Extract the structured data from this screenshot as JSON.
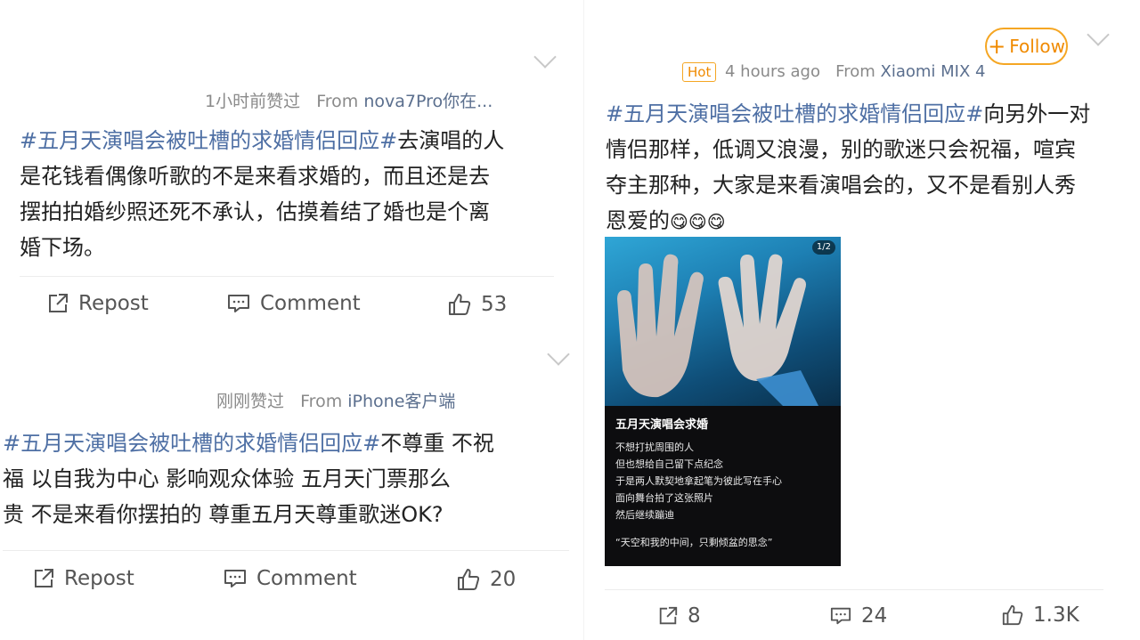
{
  "left_top_post": {
    "meta_time": "1小时前赞过",
    "from_label": "From",
    "device": "nova7Pro你在...",
    "hashtag": "#五月天演唱会被吐槽的求婚情侣回应#",
    "lines": [
      "去演唱的人",
      "是花钱看偶像听歌的不是来看求婚的，而且还是去",
      "摆拍拍婚纱照还死不承认，估摸着结了婚也是个离",
      "婚下场。"
    ],
    "repost_label": "Repost",
    "comment_label": "Comment",
    "like_count": "53"
  },
  "left_bottom_post": {
    "meta_time": "刚刚赞过",
    "from_label": "From",
    "device": "iPhone客户端",
    "hashtag": "#五月天演唱会被吐槽的求婚情侣回应#",
    "lines": [
      "不尊重 不祝",
      "福  以自我为中心  影响观众体验  五月天门票那么",
      "贵 不是来看你摆拍的  尊重五月天尊重歌迷OK?"
    ],
    "repost_label": "Repost",
    "comment_label": "Comment",
    "like_count": "20"
  },
  "right_post": {
    "follow_label": "Follow",
    "hot_badge": "Hot",
    "meta_time": "4 hours ago",
    "from_label": "From",
    "device": "Xiaomi MIX 4",
    "hashtag": "#五月天演唱会被吐槽的求婚情侣回应#",
    "lines": [
      "向另外一对",
      "情侣那样，低调又浪漫，别的歌迷只会祝福，喧宾",
      "夺主那种，大家是来看演唱会的，又不是看别人秀",
      "恩爱的"
    ],
    "image": {
      "pager": "1/2",
      "title": "五月天演唱会求婚",
      "lines": [
        "不想打扰周围的人",
        "但也想给自己留下点纪念",
        "于是两人默契地拿起笔为彼此写在手心",
        "面向舞台拍了这张照片",
        "然后继续蹦迪"
      ],
      "quote": "“天空和我的中间，只剩倾盆的思念”"
    },
    "repost_count": "8",
    "comment_count": "24",
    "like_count": "1.3K"
  },
  "colors": {
    "hashtag": "#4e6fa4",
    "follow": "#f5a623",
    "meta": "#8a8a8a"
  },
  "icons": [
    "repost-icon",
    "comment-icon",
    "like-icon",
    "chevron-down-icon",
    "plus-icon",
    "emoji-icon"
  ]
}
